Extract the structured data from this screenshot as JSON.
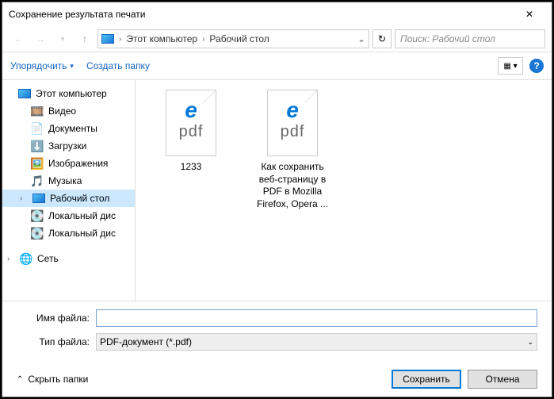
{
  "title": "Сохранение результата печати",
  "breadcrumb": {
    "seg1": "Этот компьютер",
    "seg2": "Рабочий стол"
  },
  "search": {
    "placeholder": "Поиск: Рабочий стол"
  },
  "toolbar": {
    "organize": "Упорядочить",
    "newfolder": "Создать папку"
  },
  "tree": {
    "computer": "Этот компьютер",
    "video": "Видео",
    "documents": "Документы",
    "downloads": "Загрузки",
    "images": "Изображения",
    "music": "Музыка",
    "desktop": "Рабочий стол",
    "disk1": "Локальный дис",
    "disk2": "Локальный дис",
    "network": "Сеть"
  },
  "files": {
    "f1": {
      "name": "1233",
      "ext": "pdf"
    },
    "f2": {
      "name": "Как сохранить веб-страницу в PDF в Mozilla Firefox, Opera ...",
      "ext": "pdf"
    }
  },
  "form": {
    "filename_label": "Имя файла:",
    "filetype_label": "Тип файла:",
    "filename_value": "",
    "filetype_value": "PDF-документ (*.pdf)"
  },
  "footer": {
    "hide": "Скрыть папки",
    "save": "Сохранить",
    "cancel": "Отмена"
  },
  "help": "?"
}
